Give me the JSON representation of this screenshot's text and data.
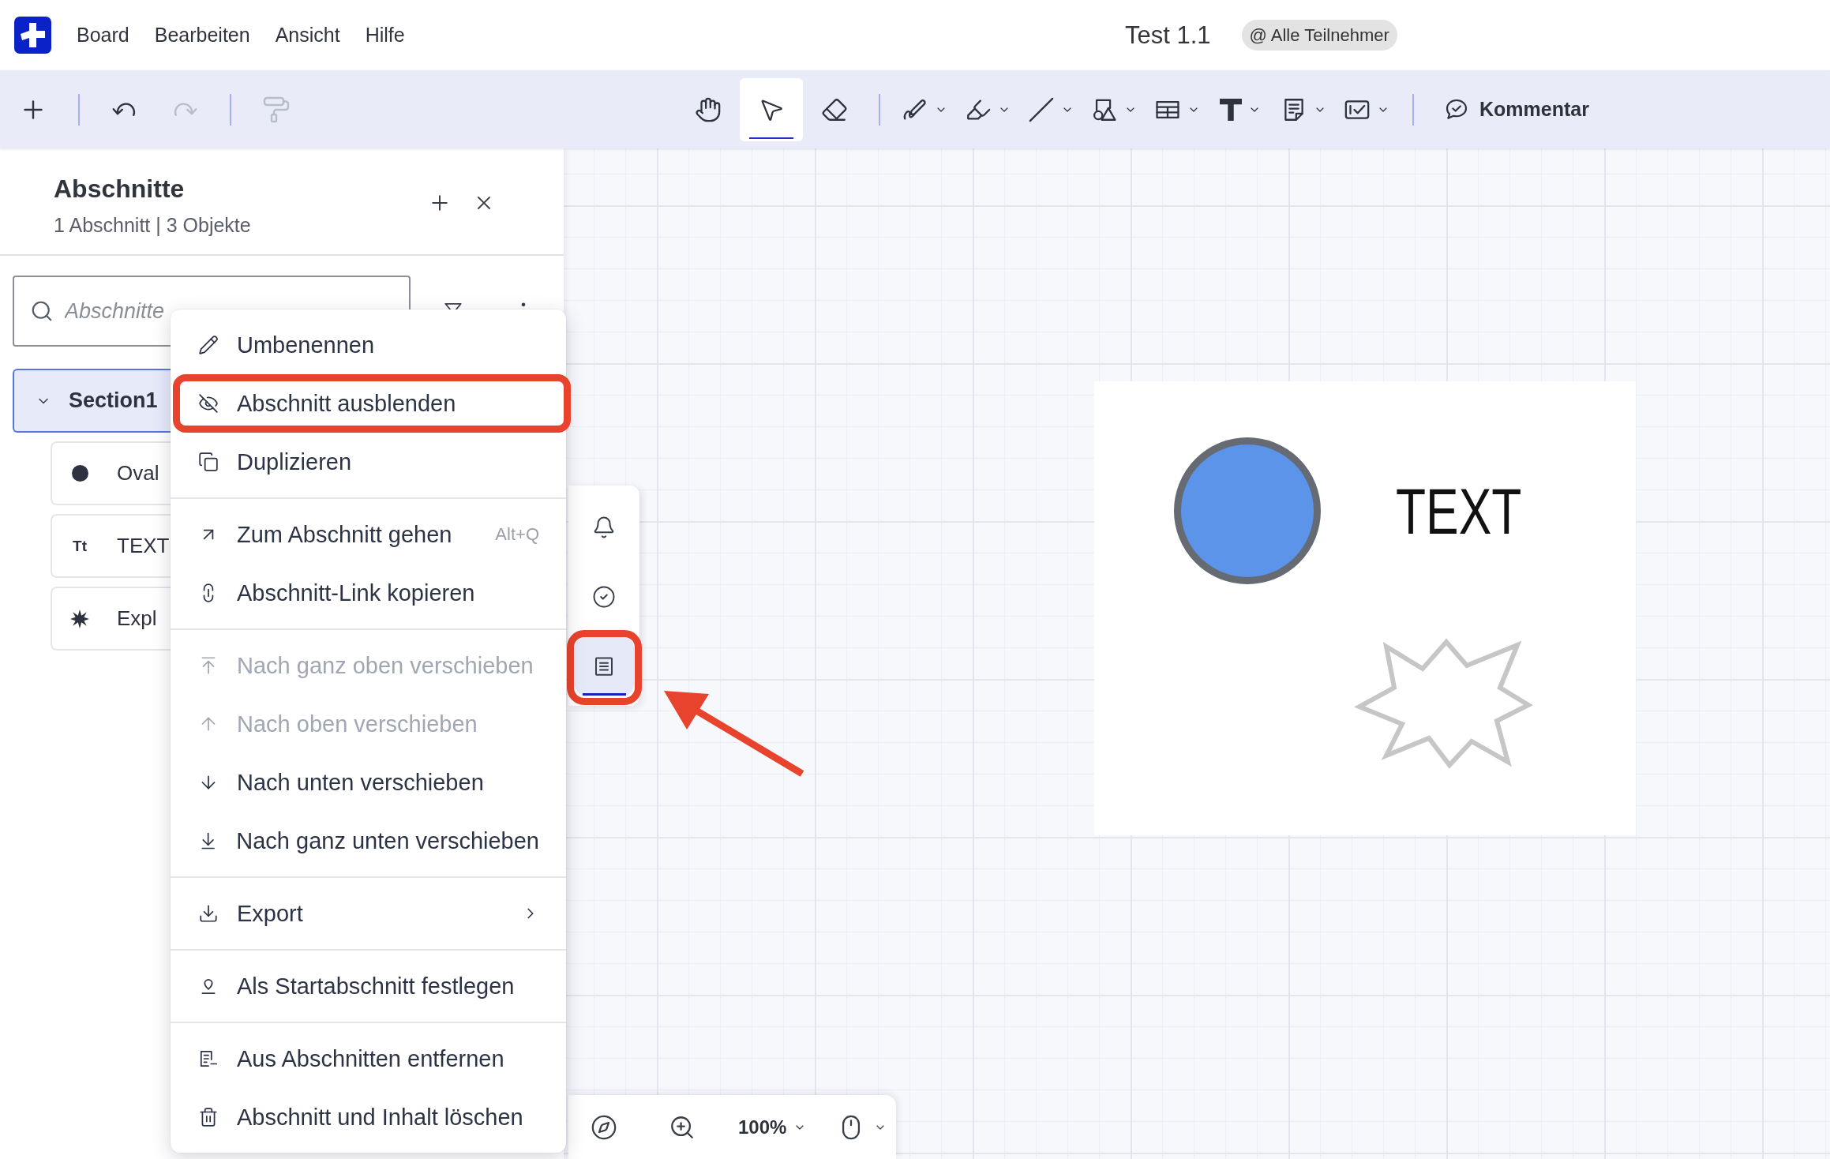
{
  "app_bar": {
    "menus": [
      "Board",
      "Bearbeiten",
      "Ansicht",
      "Hilfe"
    ],
    "title": "Test 1.1",
    "audience": "@ Alle Teilnehmer"
  },
  "toolbar": {
    "edit_groups": [
      [
        {
          "disabled": false
        }
      ],
      [
        {
          "disabled": false
        },
        {
          "disabled": true
        }
      ],
      [
        {
          "disabled": true
        }
      ]
    ],
    "tool_groups": [
      [
        {
          "selected": false,
          "dropdown": false
        },
        {
          "selected": true,
          "dropdown": false
        },
        {
          "selected": false,
          "dropdown": false
        }
      ],
      [
        {
          "selected": false,
          "dropdown": true
        },
        {
          "selected": false,
          "dropdown": true
        },
        {
          "selected": false,
          "dropdown": true
        },
        {
          "selected": false,
          "dropdown": true
        },
        {
          "selected": false,
          "dropdown": true
        },
        {
          "selected": false,
          "dropdown": true
        },
        {
          "selected": false,
          "dropdown": true
        },
        {
          "selected": false,
          "dropdown": true
        }
      ]
    ],
    "comment_button": "Kommentar"
  },
  "sections_panel": {
    "title": "Abschnitte",
    "summary": "1 Abschnitt | 3 Objekte",
    "search": {
      "placeholder": "Abschnitte"
    },
    "sections": [
      {
        "name": "Section1",
        "selected": true,
        "expanded": true,
        "children": [
          {
            "name": "Oval",
            "kind": "oval"
          },
          {
            "name": "TEXT",
            "kind": "text",
            "glyph": "Tt"
          },
          {
            "name": "Expl",
            "kind": "explosion"
          }
        ]
      }
    ]
  },
  "context_menu": {
    "groups": [
      [
        {
          "label": "Umbenennen",
          "disabled": false,
          "submenu": false,
          "annotated": false
        },
        {
          "label": "Abschnitt ausblenden",
          "disabled": false,
          "submenu": false,
          "annotated": true
        },
        {
          "label": "Duplizieren",
          "disabled": false,
          "submenu": false,
          "annotated": false
        }
      ],
      [
        {
          "label": "Zum Abschnitt gehen",
          "shortcut": "Alt+Q",
          "disabled": false,
          "submenu": false,
          "annotated": false
        },
        {
          "label": "Abschnitt-Link kopieren",
          "disabled": false,
          "submenu": false,
          "annotated": false
        }
      ],
      [
        {
          "label": "Nach ganz oben verschieben",
          "disabled": true,
          "submenu": false,
          "annotated": false
        },
        {
          "label": "Nach oben verschieben",
          "disabled": true,
          "submenu": false,
          "annotated": false
        },
        {
          "label": "Nach unten verschieben",
          "disabled": false,
          "submenu": false,
          "annotated": false
        },
        {
          "label": "Nach ganz unten verschieben",
          "disabled": false,
          "submenu": false,
          "annotated": false
        }
      ],
      [
        {
          "label": "Export",
          "disabled": false,
          "submenu": true,
          "annotated": false
        }
      ],
      [
        {
          "label": "Als Startabschnitt festlegen",
          "disabled": false,
          "submenu": false,
          "annotated": false
        }
      ],
      [
        {
          "label": "Aus Abschnitten entfernen",
          "disabled": false,
          "submenu": false,
          "annotated": false
        },
        {
          "label": "Abschnitt und Inhalt löschen",
          "disabled": false,
          "submenu": false,
          "annotated": false
        }
      ]
    ]
  },
  "side_tools": [
    {
      "selected": false,
      "annotated": false
    },
    {
      "selected": false,
      "annotated": false
    },
    {
      "selected": true,
      "annotated": true
    }
  ],
  "view_controls": {
    "zoom": "100%"
  },
  "board": {
    "frame": {
      "objects": [
        {
          "kind": "oval"
        },
        {
          "kind": "text",
          "text": "TEXT"
        },
        {
          "kind": "explosion"
        }
      ]
    }
  }
}
